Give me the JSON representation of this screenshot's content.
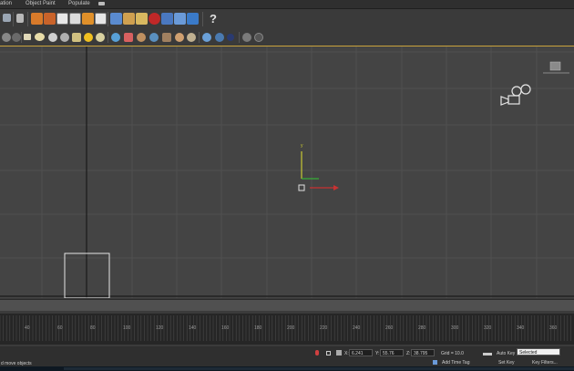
{
  "menu": {
    "items": [
      "ation",
      "Object Paint",
      "Populate"
    ]
  },
  "toolbar": {
    "row1_icons": [
      "square-icon",
      "delete-icon",
      "fire-icon",
      "fire-icon",
      "particle-icon",
      "particle-icon",
      "fire-icon",
      "particle-icon",
      "material-icon",
      "render-icon",
      "render-icon",
      "stop-icon",
      "render-icon",
      "render-icon",
      "render-icon",
      "help-icon"
    ],
    "row2_icons": [
      "sphere-icon",
      "sphere-icon",
      "sphere-icon",
      "cone-icon",
      "sun-icon",
      "gem-icon",
      "spline-icon",
      "torus-icon",
      "teapot-icon",
      "sphere-icon",
      "box-icon",
      "sphere-icon",
      "sphere-icon",
      "sphere-icon",
      "settings-icon"
    ],
    "help_glyph": "?"
  },
  "viewport": {
    "axis_y_label": "y"
  },
  "timeline": {
    "ticks": [
      "40",
      "60",
      "80",
      "100",
      "120",
      "140",
      "160",
      "180",
      "200",
      "220",
      "240",
      "260",
      "280",
      "300",
      "320",
      "340",
      "360"
    ]
  },
  "status": {
    "x_value": "6.241",
    "y_value": "55.76",
    "z_value": "38.795",
    "grid": "Grid = 10.0",
    "auto_key": "Auto Key",
    "selected": "Selected",
    "set_key": "Set Key",
    "key_filters": "Key Filters...",
    "add_time_tag": "Add Time Tag",
    "prompt": "d move objects"
  },
  "colors": {
    "accent": "#c9a23c",
    "axis_y": "#c8c832",
    "axis_x": "#c83232",
    "axis_z": "#32c832"
  }
}
